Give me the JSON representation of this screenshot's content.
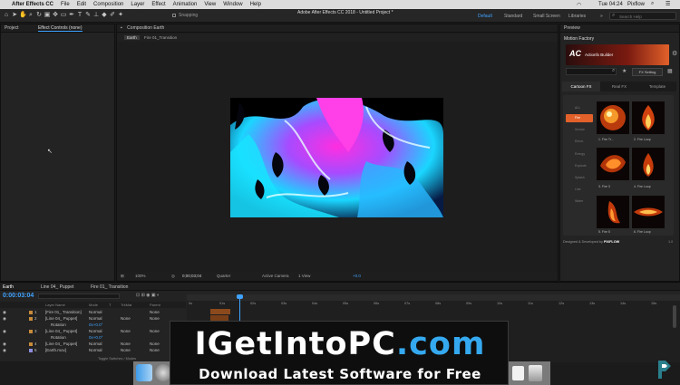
{
  "menubar": {
    "apple": "",
    "app_name": "After Effects CC",
    "items": [
      "File",
      "Edit",
      "Composition",
      "Layer",
      "Effect",
      "Animation",
      "View",
      "Window",
      "Help"
    ],
    "clock": "Tue 04:24",
    "user": "Pixflow"
  },
  "toolbar": {
    "window_title": "Adobe After Effects CC 2018 - Untitled Project *",
    "snapping": "Snapping",
    "workspaces": [
      "Default",
      "Standard",
      "Small Screen",
      "Libraries"
    ],
    "search_placeholder": "Search Help"
  },
  "left_panel": {
    "tab_project": "Project",
    "tab_effect_controls": "Effect Controls (none)"
  },
  "composition_panel": {
    "tab": "Composition Earth",
    "breadcrumb": [
      "Earth",
      "Fire 01_Transition"
    ],
    "zoom": "100%",
    "timecode": "0;00;03;04",
    "resolution": "Quarter",
    "camera": "Active Camera",
    "views": "1 View",
    "offset": "+0.0"
  },
  "right_panel": {
    "panel_title": "Preview",
    "plugin_title": "Motion Factory",
    "brand": "Actionfx Builder",
    "fx_setting": "FX Setting",
    "tabs": [
      "Cartoon FX",
      "Real FX",
      "Template"
    ],
    "categories": [
      "ALL",
      "Fire",
      "Smoke",
      "Electr.",
      "Energy",
      "Explode",
      "Splash",
      "Line",
      "Water"
    ],
    "effects": [
      "1. Fire Tr...",
      "2. Fire Loop",
      "3. Fire 3",
      "4. Fire Loop",
      "5. Fire 5",
      "6. Fire Loop"
    ],
    "footer": "Designed & Developed by",
    "footer_brand": "PIXFLOW",
    "version": "1.0"
  },
  "timeline": {
    "tabs": [
      "Earth",
      "Line 04_ Puppet",
      "Fire 01_ Transition"
    ],
    "timecode": "0:00:03:04",
    "columns": [
      "Layer Name",
      "Mode",
      "T",
      "TrkMat",
      "Parent"
    ],
    "layers": [
      {
        "num": "1",
        "name": "[Fire 01_ Transition]",
        "mode": "Normal",
        "trk": "",
        "parent": "None",
        "color": "#c98b3a"
      },
      {
        "num": "2",
        "name": "[Line 04_ Puppet]",
        "mode": "Normal",
        "trk": "None",
        "parent": "None",
        "color": "#c98b3a"
      },
      {
        "num": "",
        "name": "Rotation",
        "mode": "0x+0.0°",
        "trk": "",
        "parent": "",
        "color": ""
      },
      {
        "num": "3",
        "name": "[Line 04_ Puppet]",
        "mode": "Normal",
        "trk": "None",
        "parent": "None",
        "color": "#c98b3a"
      },
      {
        "num": "",
        "name": "Rotation",
        "mode": "0x+0.0°",
        "trk": "",
        "parent": "",
        "color": ""
      },
      {
        "num": "4",
        "name": "[Line 04_ Puppet]",
        "mode": "Normal",
        "trk": "None",
        "parent": "None",
        "color": "#c98b3a"
      },
      {
        "num": "5",
        "name": "[Earth.mov]",
        "mode": "Normal",
        "trk": "None",
        "parent": "None",
        "color": "#8e8ee0"
      }
    ],
    "ruler": [
      "0s",
      "01s",
      "02s",
      "03s",
      "04s",
      "05s",
      "06s",
      "07s",
      "08s",
      "09s",
      "10s",
      "11s",
      "12s",
      "13s",
      "14s",
      "15s"
    ],
    "footer": "Toggle Switches / Modes"
  },
  "banner": {
    "title_part1": "IGetIntoPC",
    "title_part2": ".com",
    "subtitle": "Download Latest Software for Free"
  },
  "colors": {
    "accent_blue": "#2d8ceb",
    "playhead": "#3fa3ff",
    "plugin_orange": "#e2612a"
  }
}
